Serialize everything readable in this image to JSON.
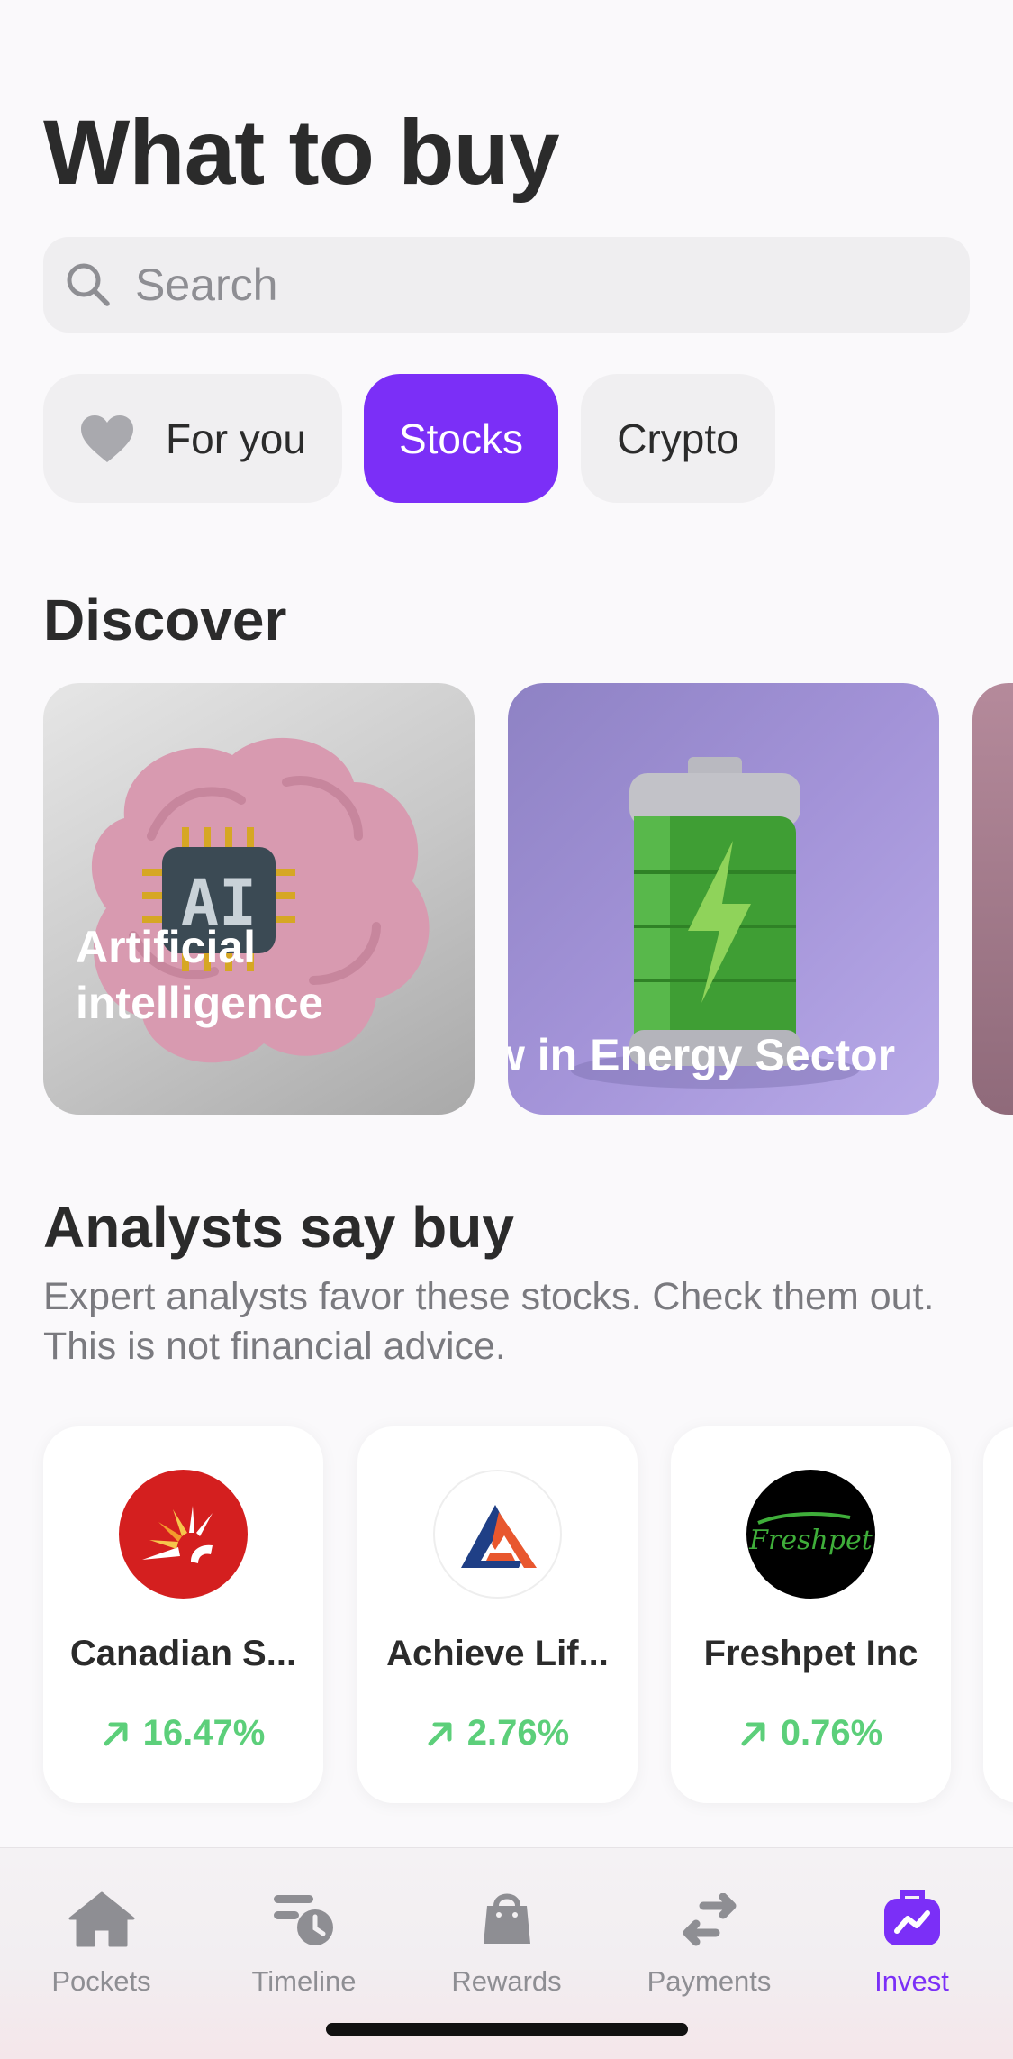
{
  "page": {
    "title": "What to buy"
  },
  "search": {
    "placeholder": "Search"
  },
  "filters": [
    {
      "label": "For you",
      "icon": "heart-icon"
    },
    {
      "label": "Stocks",
      "active": true
    },
    {
      "label": "Crypto"
    }
  ],
  "discover": {
    "heading": "Discover",
    "cards": [
      {
        "label": "Artificial intelligence",
        "icon": "ai-brain-illustration"
      },
      {
        "label": "w in Energy Sector",
        "icon": "battery-illustration"
      }
    ]
  },
  "analysts": {
    "heading": "Analysts say buy",
    "subtitle": "Expert analysts favor these stocks. Check them out. This is not financial advice.",
    "stocks": [
      {
        "name": "Canadian S...",
        "change": "16.47%"
      },
      {
        "name": "Achieve Lif...",
        "change": "2.76%"
      },
      {
        "name": "Freshpet Inc",
        "change": "0.76%",
        "logo_text": "Freshpet"
      }
    ]
  },
  "tabbar": {
    "items": [
      {
        "label": "Pockets",
        "icon": "home-icon"
      },
      {
        "label": "Timeline",
        "icon": "timeline-icon"
      },
      {
        "label": "Rewards",
        "icon": "shopping-bag-icon"
      },
      {
        "label": "Payments",
        "icon": "transfer-arrows-icon"
      },
      {
        "label": "Invest",
        "icon": "invest-briefcase-icon",
        "active": true
      }
    ]
  },
  "colors": {
    "accent": "#7B2FF7",
    "positive": "#5CCF7A",
    "text": "#2B2B2B",
    "muted": "#8E8E93"
  }
}
